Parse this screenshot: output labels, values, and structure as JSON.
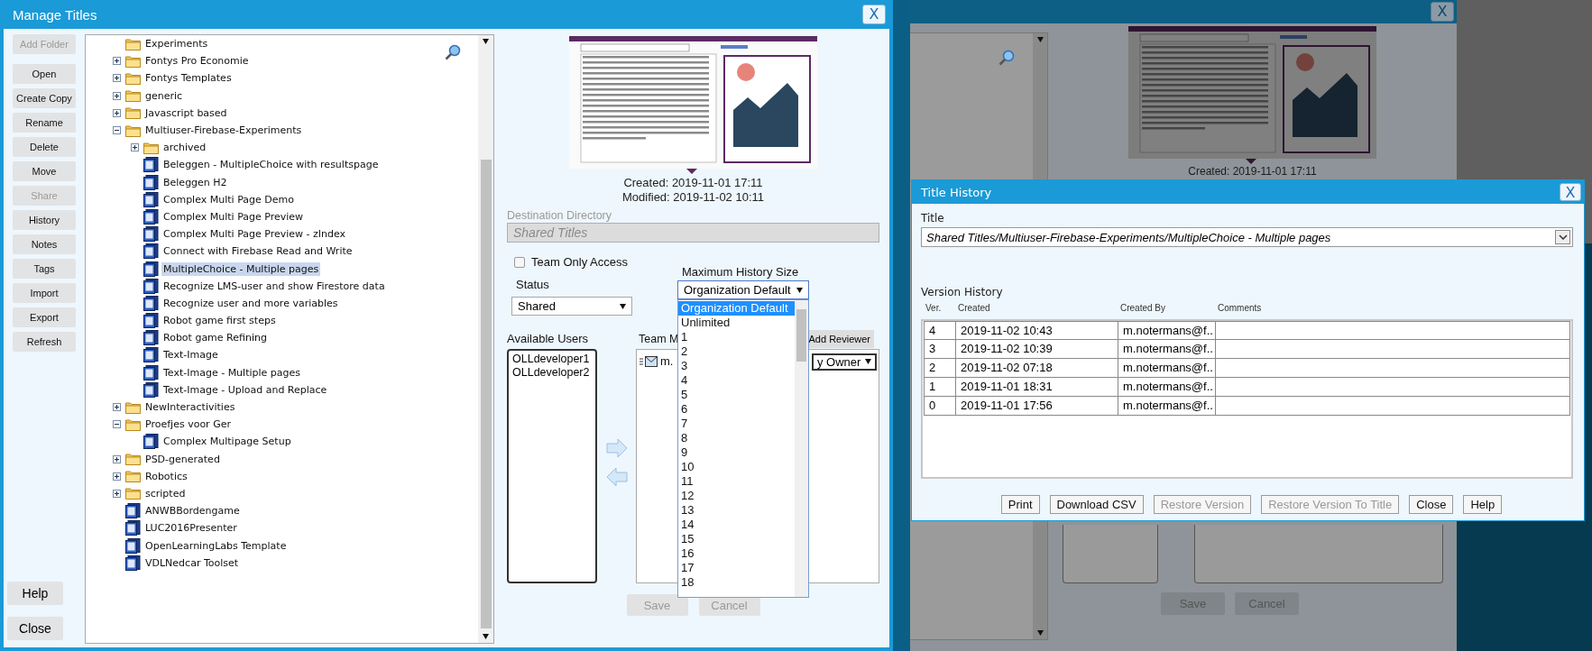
{
  "manage_titles": {
    "title": "Manage Titles",
    "close": "X",
    "actions": [
      {
        "label": "Add Folder",
        "disabled": true
      },
      {
        "label": "Open",
        "disabled": false
      },
      {
        "label": "Create Copy",
        "disabled": false
      },
      {
        "label": "Rename",
        "disabled": false
      },
      {
        "label": "Delete",
        "disabled": false
      },
      {
        "label": "Move",
        "disabled": false
      },
      {
        "label": "Share",
        "disabled": true
      },
      {
        "label": "History",
        "disabled": false
      },
      {
        "label": "Notes",
        "disabled": false
      },
      {
        "label": "Tags",
        "disabled": false
      },
      {
        "label": "Import",
        "disabled": false
      },
      {
        "label": "Export",
        "disabled": false
      },
      {
        "label": "Refresh",
        "disabled": false
      }
    ],
    "footer_buttons": [
      "Help",
      "Close"
    ],
    "tree": [
      {
        "kind": "leaf_folder",
        "label": "Experiments",
        "selected": false
      },
      {
        "kind": "folder",
        "label": "Fontys Pro Economie",
        "expanded": false,
        "selected": false
      },
      {
        "kind": "folder",
        "label": "Fontys Templates",
        "expanded": false,
        "selected": false
      },
      {
        "kind": "folder",
        "label": "generic",
        "expanded": false,
        "selected": false
      },
      {
        "kind": "folder",
        "label": "Javascript based",
        "expanded": false,
        "selected": false
      },
      {
        "kind": "folder",
        "label": "Multiuser-Firebase-Experiments",
        "expanded": true,
        "selected": false,
        "children": [
          {
            "kind": "folder",
            "label": "archived",
            "expanded": false,
            "selected": false
          },
          {
            "kind": "title",
            "label": "Beleggen - MultipleChoice with resultspage",
            "selected": false
          },
          {
            "kind": "title",
            "label": "Beleggen H2",
            "selected": false
          },
          {
            "kind": "title",
            "label": "Complex Multi Page Demo",
            "selected": false
          },
          {
            "kind": "title",
            "label": "Complex Multi Page Preview",
            "selected": false
          },
          {
            "kind": "title",
            "label": "Complex Multi Page Preview - zIndex",
            "selected": false
          },
          {
            "kind": "title",
            "label": "Connect with Firebase Read and Write",
            "selected": false
          },
          {
            "kind": "title",
            "label": "MultipleChoice - Multiple pages",
            "selected": true
          },
          {
            "kind": "title",
            "label": "Recognize LMS-user and show Firestore data",
            "selected": false
          },
          {
            "kind": "title",
            "label": "Recognize user and more variables",
            "selected": false
          },
          {
            "kind": "title",
            "label": "Robot game first steps",
            "selected": false
          },
          {
            "kind": "title",
            "label": "Robot game Refining",
            "selected": false
          },
          {
            "kind": "title",
            "label": "Text-Image",
            "selected": false
          },
          {
            "kind": "title",
            "label": "Text-Image - Multiple pages",
            "selected": false
          },
          {
            "kind": "title",
            "label": "Text-Image - Upload and Replace",
            "selected": false
          }
        ]
      },
      {
        "kind": "folder",
        "label": "NewInteractivities",
        "expanded": false,
        "selected": false
      },
      {
        "kind": "folder",
        "label": "Proefjes voor Ger",
        "expanded": true,
        "selected": false,
        "children": [
          {
            "kind": "title",
            "label": "Complex Multipage Setup",
            "selected": false
          }
        ]
      },
      {
        "kind": "folder",
        "label": "PSD-generated",
        "expanded": false,
        "selected": false
      },
      {
        "kind": "folder",
        "label": "Robotics",
        "expanded": false,
        "selected": false
      },
      {
        "kind": "folder",
        "label": "scripted",
        "expanded": false,
        "selected": false
      },
      {
        "kind": "title",
        "label": "ANWBBordengame",
        "selected": false
      },
      {
        "kind": "title",
        "label": "LUC2016Presenter",
        "selected": false
      },
      {
        "kind": "title",
        "label": "OpenLearningLabs Template",
        "selected": false
      },
      {
        "kind": "title",
        "label": "VDLNedcar Toolset",
        "selected": false
      }
    ],
    "created": "Created: 2019-11-01 17:11",
    "modified": "Modified: 2019-11-02 10:11",
    "destination": {
      "label": "Destination Directory",
      "value": "Shared Titles",
      "disabled": true
    },
    "team_only_access": {
      "label": "Team Only Access",
      "checked": false
    },
    "status": {
      "label": "Status",
      "value": "Shared"
    },
    "max_history": {
      "label": "Maximum History Size",
      "value": "Organization Default",
      "expanded": true,
      "options": [
        {
          "label": "Organization Default",
          "selected": true
        },
        {
          "label": "Unlimited",
          "selected": false
        },
        {
          "label": "1",
          "selected": false
        },
        {
          "label": "2",
          "selected": false
        },
        {
          "label": "3",
          "selected": false
        },
        {
          "label": "4",
          "selected": false
        },
        {
          "label": "5",
          "selected": false
        },
        {
          "label": "6",
          "selected": false
        },
        {
          "label": "7",
          "selected": false
        },
        {
          "label": "8",
          "selected": false
        },
        {
          "label": "9",
          "selected": false
        },
        {
          "label": "10",
          "selected": false
        },
        {
          "label": "11",
          "selected": false
        },
        {
          "label": "12",
          "selected": false
        },
        {
          "label": "13",
          "selected": false
        },
        {
          "label": "14",
          "selected": false
        },
        {
          "label": "15",
          "selected": false
        },
        {
          "label": "16",
          "selected": false
        },
        {
          "label": "17",
          "selected": false
        },
        {
          "label": "18",
          "selected": false
        }
      ]
    },
    "available_users": {
      "label": "Available Users",
      "items": [
        "OLLdeveloper1",
        "OLLdeveloper2"
      ]
    },
    "team_members": {
      "label": "Team M",
      "add_reviewer": "Add Reviewer",
      "member": "m.",
      "role": "y Owner"
    },
    "buttons": [
      {
        "label": "Save",
        "disabled": true
      },
      {
        "label": "Cancel",
        "disabled": true
      }
    ]
  },
  "background_window": {
    "close": "X",
    "created": "Created: 2019-11-01 17:11",
    "buttons": [
      "Save",
      "Cancel"
    ]
  },
  "title_history": {
    "title": "Title History",
    "close": "X",
    "title_label": "Title",
    "title_value": "Shared Titles/Multiuser-Firebase-Experiments/MultipleChoice - Multiple pages",
    "section": "Version History",
    "columns": [
      "Ver.",
      "Created",
      "Created By",
      "Comments"
    ],
    "rows": [
      {
        "ver": "4",
        "created": "2019-11-02 10:43",
        "created_by": "m.notermans@f.."
      },
      {
        "ver": "3",
        "created": "2019-11-02 10:39",
        "created_by": "m.notermans@f.."
      },
      {
        "ver": "2",
        "created": "2019-11-02 07:18",
        "created_by": "m.notermans@f.."
      },
      {
        "ver": "1",
        "created": "2019-11-01 18:31",
        "created_by": "m.notermans@f.."
      },
      {
        "ver": "0",
        "created": "2019-11-01 17:56",
        "created_by": "m.notermans@f.."
      }
    ],
    "buttons": [
      {
        "label": "Print",
        "disabled": false
      },
      {
        "label": "Download CSV",
        "disabled": false
      },
      {
        "label": "Restore Version",
        "disabled": true
      },
      {
        "label": "Restore Version To Title",
        "disabled": true
      },
      {
        "label": "Close",
        "disabled": false
      },
      {
        "label": "Help",
        "disabled": false
      }
    ]
  }
}
